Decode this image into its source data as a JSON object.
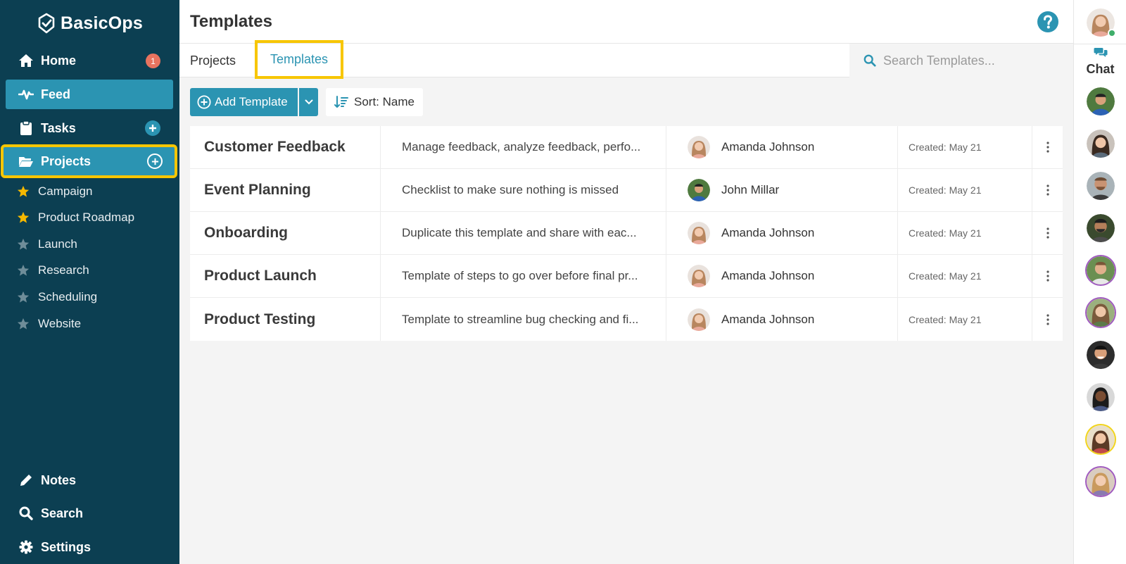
{
  "app": {
    "brand": "BasicOps"
  },
  "sidebar": {
    "nav": {
      "home": {
        "label": "Home",
        "badge": "1"
      },
      "feed": {
        "label": "Feed"
      },
      "tasks": {
        "label": "Tasks"
      },
      "projects": {
        "label": "Projects"
      }
    },
    "projects": [
      {
        "label": "Campaign",
        "starred": true
      },
      {
        "label": "Product Roadmap",
        "starred": true
      },
      {
        "label": "Launch",
        "starred": false
      },
      {
        "label": "Research",
        "starred": false
      },
      {
        "label": "Scheduling",
        "starred": false
      },
      {
        "label": "Website",
        "starred": false
      }
    ],
    "bottom": {
      "notes": {
        "label": "Notes"
      },
      "search": {
        "label": "Search"
      },
      "settings": {
        "label": "Settings"
      }
    }
  },
  "header": {
    "title": "Templates",
    "help_icon": "question-circle-icon"
  },
  "tabs": [
    {
      "label": "Projects",
      "active": false
    },
    {
      "label": "Templates",
      "active": true
    }
  ],
  "search": {
    "placeholder": "Search Templates..."
  },
  "toolbar": {
    "add_label": "Add Template",
    "sort_label": "Sort: Name"
  },
  "templates": [
    {
      "name": "Customer Feedback",
      "description": "Manage feedback, analyze feedback, perfo...",
      "owner": "Amanda Johnson",
      "created": "Created: May 21"
    },
    {
      "name": "Event Planning",
      "description": "Checklist to make sure nothing is missed",
      "owner": "John Millar",
      "created": "Created: May 21"
    },
    {
      "name": "Onboarding",
      "description": "Duplicate this template and share with eac...",
      "owner": "Amanda Johnson",
      "created": "Created: May 21"
    },
    {
      "name": "Product Launch",
      "description": "Template of steps to go over before final pr...",
      "owner": "Amanda Johnson",
      "created": "Created: May 21"
    },
    {
      "name": "Product Testing",
      "description": "Template to streamline bug checking and fi...",
      "owner": "Amanda Johnson",
      "created": "Created: May 21"
    }
  ],
  "right_rail": {
    "chat_label": "Chat"
  },
  "colors": {
    "sidebar": "#0c3f52",
    "accent": "#2b94b2",
    "highlight": "#f7c600",
    "badge": "#e8735f",
    "star": "#f5b800"
  }
}
